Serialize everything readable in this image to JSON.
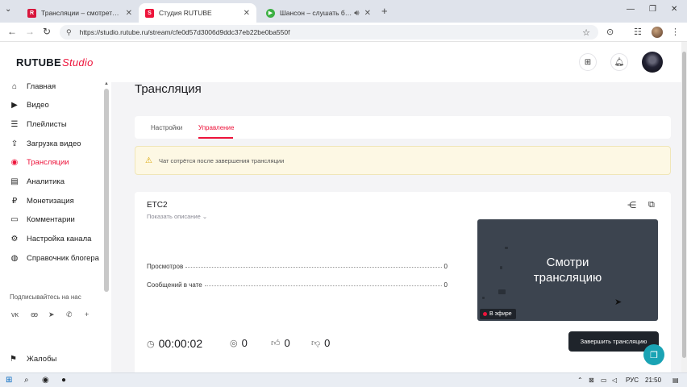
{
  "browser": {
    "tabs": [
      {
        "title": "Трансляции – смотреть все в",
        "favicon": "R",
        "favicon_color": "#d8163c",
        "active": false
      },
      {
        "title": "Студия RUTUBE",
        "favicon": "S",
        "favicon_color": "#ed143b",
        "active": true
      },
      {
        "title": "Шансон – слушать бесплат",
        "favicon": "▶",
        "favicon_color": "#3cb043",
        "active": false
      }
    ],
    "url": "https://studio.rutube.ru/stream/cfe0d57d3006d9ddc37eb22be0ba550f"
  },
  "header": {
    "logo_main": "RUTUBE",
    "logo_sub": "Studio"
  },
  "sidebar": {
    "items": [
      {
        "label": "Главная",
        "icon": "home-icon",
        "glyph": "⌂"
      },
      {
        "label": "Видео",
        "icon": "video-icon",
        "glyph": "▶"
      },
      {
        "label": "Плейлисты",
        "icon": "playlist-icon",
        "glyph": "☰"
      },
      {
        "label": "Загрузка видео",
        "icon": "upload-icon",
        "glyph": "⇪"
      },
      {
        "label": "Трансляции",
        "icon": "broadcast-icon",
        "glyph": "◉"
      },
      {
        "label": "Аналитика",
        "icon": "analytics-icon",
        "glyph": "▤"
      },
      {
        "label": "Монетизация",
        "icon": "money-icon",
        "glyph": "₽"
      },
      {
        "label": "Комментарии",
        "icon": "comments-icon",
        "glyph": "▭"
      },
      {
        "label": "Настройка канала",
        "icon": "settings-icon",
        "glyph": "⚙"
      },
      {
        "label": "Справочник блогера",
        "icon": "guide-icon",
        "glyph": "◍"
      }
    ],
    "active_index": 4,
    "social_title": "Подписывайтесь на нас",
    "social_icons": [
      "vk-icon",
      "ok-icon",
      "telegram-icon",
      "viber-icon",
      "plus-icon"
    ],
    "complaints_label": "Жалобы"
  },
  "main": {
    "title": "Трансляция",
    "tabs": [
      {
        "label": "Настройки"
      },
      {
        "label": "Управление"
      }
    ],
    "active_tab": 1,
    "warning": "Чат сотрётся после завершения трансляции",
    "stream": {
      "name": "ETC2",
      "show_description": "Показать описание",
      "stats": [
        {
          "label": "Просмотров",
          "value": "0"
        },
        {
          "label": "Сообщений в чате",
          "value": "0"
        }
      ],
      "preview_line1": "Смотри",
      "preview_line2": "трансляцию",
      "live_badge": "В эфире",
      "timer": "00:00:02",
      "viewers": "0",
      "likes": "0",
      "dislikes": "0",
      "end_button": "Завершить трансляцию"
    }
  },
  "taskbar": {
    "lang": "РУС",
    "time": "21:50"
  },
  "colors": {
    "accent": "#ed143b",
    "warning_bg": "#fdf8e4",
    "preview_bg": "#3c444f",
    "button_dark": "#1f242b",
    "help_fab": "#1aa3b4"
  }
}
